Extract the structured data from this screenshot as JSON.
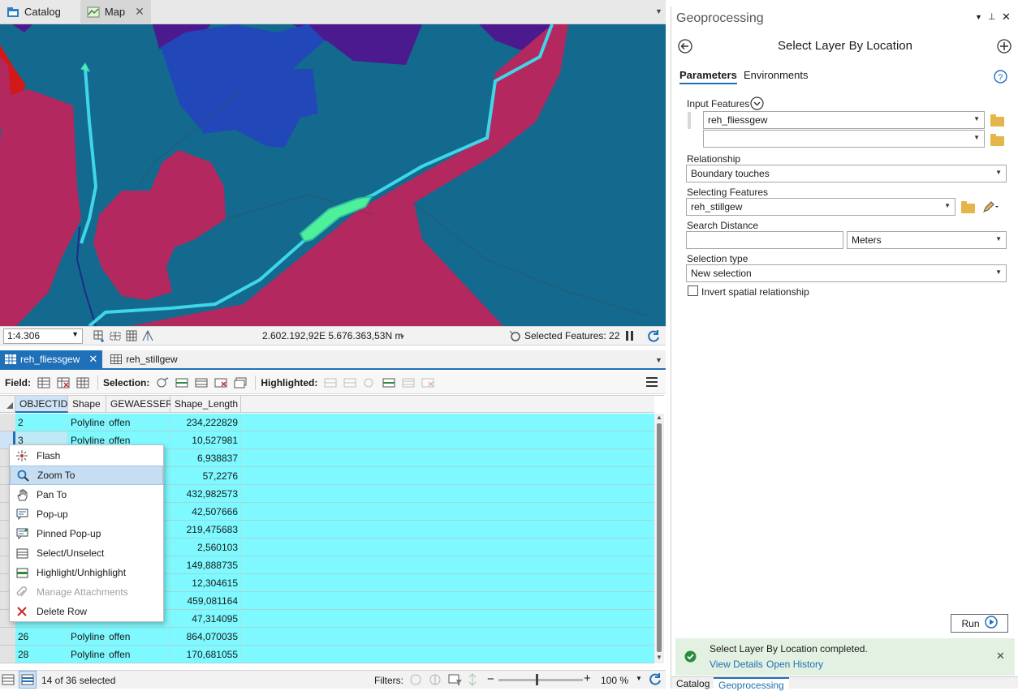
{
  "doc_tabs": [
    {
      "label": "Catalog",
      "icon": "catalog-icon",
      "active": false
    },
    {
      "label": "Map",
      "icon": "map-icon",
      "active": true
    }
  ],
  "map_status": {
    "scale": "1:4.306",
    "coordinates": "2.602.192,92E 5.676.363,53N m",
    "selected_features": "Selected Features: 22"
  },
  "table_tabs": [
    {
      "label": "reh_fliessgew",
      "active": true
    },
    {
      "label": "reh_stillgew",
      "active": false
    }
  ],
  "table_toolbar": {
    "field_label": "Field:",
    "selection_label": "Selection:",
    "highlighted_label": "Highlighted:"
  },
  "table": {
    "columns": [
      "OBJECTID",
      "Shape",
      "GEWAESSER",
      "Shape_Length"
    ],
    "rows": [
      {
        "objectid": "2",
        "shape": "Polyline",
        "gewaesser": "offen",
        "length": "234,222829"
      },
      {
        "objectid": "3",
        "shape": "Polyline",
        "gewaesser": "offen",
        "length": "10,527981"
      },
      {
        "objectid": "",
        "shape": "",
        "gewaesser": "",
        "length": "6,938837"
      },
      {
        "objectid": "",
        "shape": "",
        "gewaesser": "",
        "length": "57,2276"
      },
      {
        "objectid": "",
        "shape": "",
        "gewaesser": "",
        "length": "432,982573"
      },
      {
        "objectid": "",
        "shape": "",
        "gewaesser": "",
        "length": "42,507666"
      },
      {
        "objectid": "",
        "shape": "",
        "gewaesser": "",
        "length": "219,475683"
      },
      {
        "objectid": "",
        "shape": "",
        "gewaesser": "",
        "length": "2,560103"
      },
      {
        "objectid": "",
        "shape": "",
        "gewaesser": "",
        "length": "149,888735"
      },
      {
        "objectid": "",
        "shape": "",
        "gewaesser": "",
        "length": "12,304615"
      },
      {
        "objectid": "",
        "shape": "",
        "gewaesser": "",
        "length": "459,081164"
      },
      {
        "objectid": "",
        "shape": "",
        "gewaesser": "",
        "length": "47,314095"
      },
      {
        "objectid": "26",
        "shape": "Polyline",
        "gewaesser": "offen",
        "length": "864,070035"
      },
      {
        "objectid": "28",
        "shape": "Polyline",
        "gewaesser": "offen",
        "length": "170,681055"
      }
    ]
  },
  "table_status": {
    "selected": "14 of 36 selected",
    "filters_label": "Filters:",
    "zoom": "100 %"
  },
  "context_menu": [
    {
      "label": "Flash",
      "icon": "flash-icon",
      "state": "normal"
    },
    {
      "label": "Zoom To",
      "icon": "zoom-to-icon",
      "state": "selected"
    },
    {
      "label": "Pan To",
      "icon": "pan-hand-icon",
      "state": "normal"
    },
    {
      "label": "Pop-up",
      "icon": "popup-icon",
      "state": "normal"
    },
    {
      "label": "Pinned Pop-up",
      "icon": "pinned-popup-icon",
      "state": "normal"
    },
    {
      "label": "Select/Unselect",
      "icon": "select-unselect-icon",
      "state": "normal"
    },
    {
      "label": "Highlight/Unhighlight",
      "icon": "highlight-icon",
      "state": "normal"
    },
    {
      "label": "Manage Attachments",
      "icon": "paperclip-icon",
      "state": "disabled"
    },
    {
      "label": "Delete Row",
      "icon": "delete-x-icon",
      "state": "normal"
    }
  ],
  "geoprocessing": {
    "pane_title": "Geoprocessing",
    "tool_title": "Select Layer By Location",
    "tabs": [
      "Parameters",
      "Environments"
    ],
    "input_features_label": "Input Features",
    "input_features": [
      "reh_fliessgew",
      ""
    ],
    "relationship_label": "Relationship",
    "relationship": "Boundary touches",
    "selecting_features_label": "Selecting Features",
    "selecting_features": "reh_stillgew",
    "search_distance_label": "Search Distance",
    "search_distance": "",
    "distance_unit": "Meters",
    "selection_type_label": "Selection type",
    "selection_type": "New selection",
    "invert_label": "Invert spatial relationship",
    "run_label": "Run",
    "message": "Select Layer By Location completed.",
    "view_details": "View Details",
    "open_history": "Open History",
    "bottom_tabs": [
      "Catalog",
      "Geoprocessing"
    ]
  }
}
